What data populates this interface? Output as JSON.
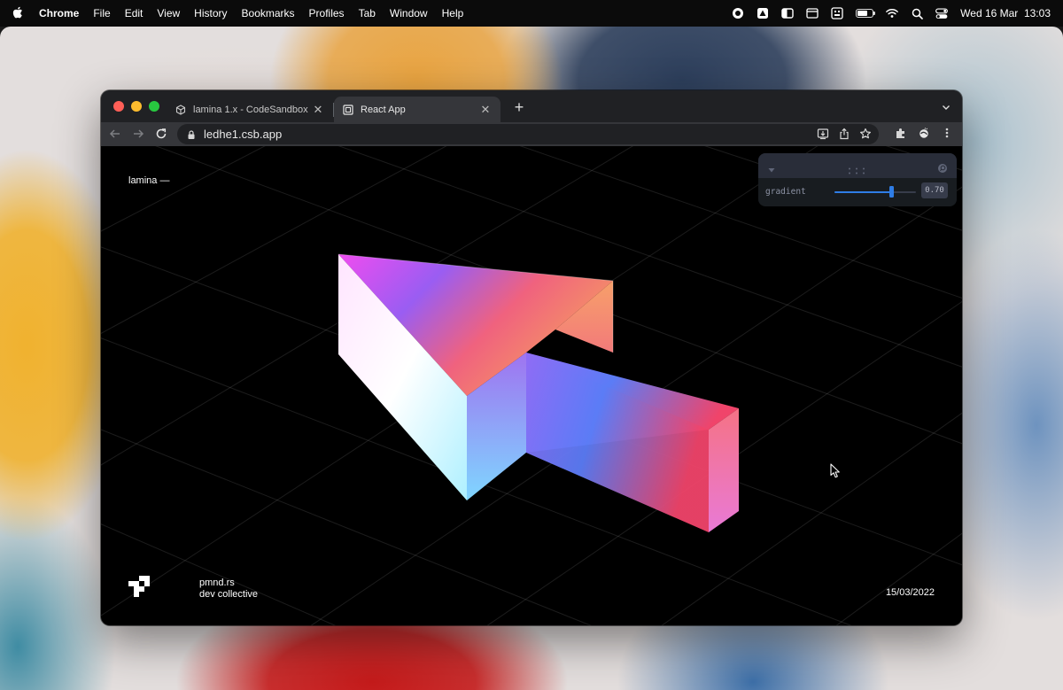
{
  "menubar": {
    "app_name": "Chrome",
    "items": [
      "File",
      "Edit",
      "View",
      "History",
      "Bookmarks",
      "Profiles",
      "Tab",
      "Window",
      "Help"
    ],
    "clock": "Wed 16 Mar  13:03"
  },
  "browser": {
    "tabs": [
      {
        "title": "lamina 1.x - CodeSandbox",
        "active": false
      },
      {
        "title": "React App",
        "active": true
      }
    ],
    "url": "ledhe1.csb.app"
  },
  "page": {
    "brand": "lamina —",
    "footer_line1": "pmnd.rs",
    "footer_line2": "dev collective",
    "date": "15/03/2022"
  },
  "controls": {
    "label": "gradient",
    "value": 0.7,
    "value_display": "0.70",
    "min": 0,
    "max": 1,
    "accent": "#2f7de6"
  },
  "icons": {
    "menubar": [
      "apple-icon",
      "screen-record-icon",
      "drive-icon",
      "sidebar-icon",
      "window-icon",
      "keyboard-icon",
      "battery-icon",
      "wifi-icon",
      "spotlight-icon",
      "control-center-icon"
    ],
    "browser": [
      "codesandbox-favicon",
      "react-favicon",
      "lock-icon",
      "install-icon",
      "share-icon",
      "bookmark-star-icon",
      "extensions-icon",
      "profile-icon",
      "kebab-menu-icon"
    ]
  }
}
